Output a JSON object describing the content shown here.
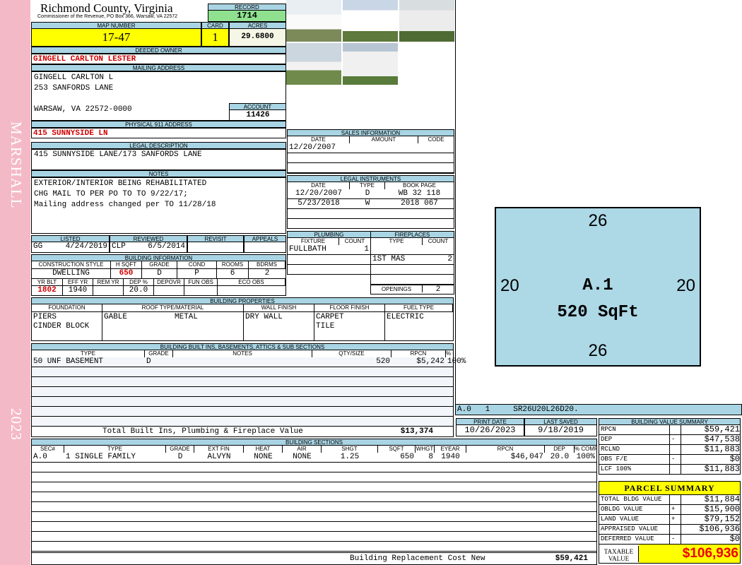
{
  "side": {
    "district": "MARSHALL",
    "year": "2023"
  },
  "header": {
    "county": "Richmond County, Virginia",
    "office": "Commissioner of the Revenue, PO Box 366, Warsaw, VA 22572",
    "record_label": "RECORD",
    "record": "1714"
  },
  "parcel": {
    "map_label": "MAP NUMBER",
    "map": "17-47",
    "card_label": "CARD",
    "card": "1",
    "acres_label": "ACRES",
    "acres": "29.6800"
  },
  "owner": {
    "label": "DEEDED OWNER",
    "name": "GINGELL CARLTON LESTER"
  },
  "mailing": {
    "label": "MAILING ADDRESS",
    "line1": "GINGELL CARLTON L",
    "line2": "253 SANFORDS LANE",
    "line3": "WARSAW, VA 22572-0000",
    "account_label": "ACCOUNT",
    "account": "11426"
  },
  "physical": {
    "label": "PHYSICAL 911 ADDRESS",
    "value": "415 SUNNYSIDE LN"
  },
  "legal": {
    "label": "LEGAL DESCRIPTION",
    "value": "415 SUNNYSIDE LANE/173 SANFORDS LANE"
  },
  "notes": {
    "label": "NOTES",
    "lines": [
      "EXTERIOR/INTERIOR BEING REHABILITATED",
      "CHG MAIL TO PER PO TO TO 9/22/17;",
      "Mailing address changed per TO 11/28/18"
    ]
  },
  "review": {
    "listed_label": "LISTED",
    "reviewed_label": "REVIEWED",
    "revisit_label": "REVISIT",
    "appeals_label": "APPEALS",
    "listed_by": "GG",
    "listed_date": "4/24/2019",
    "reviewed_by": "CLP",
    "reviewed_date": "6/5/2014"
  },
  "building_info": {
    "label": "BUILDING INFORMATION",
    "h": [
      "CONSTRUCTION STYLE",
      "H SQFT",
      "GRADE",
      "COND",
      "ROOMS",
      "BDRMS"
    ],
    "v": [
      "DWELLING",
      "650",
      "D",
      "P",
      "6",
      "2"
    ],
    "h2": [
      "YR BLT",
      "EFF YR",
      "REM YR",
      "DEP %",
      "DEPOVR",
      "FUN OBS",
      "ECO OBS"
    ],
    "v2": [
      "1802",
      "1940",
      "",
      "20.0",
      "",
      "",
      ""
    ]
  },
  "sales": {
    "label": "SALES INFORMATION",
    "h": [
      "DATE",
      "AMOUNT",
      "CODE"
    ],
    "rows": [
      [
        "12/20/2007",
        "",
        ""
      ]
    ]
  },
  "instruments": {
    "label": "LEGAL INSTRUMENTS",
    "h": [
      "DATE",
      "TYPE",
      "BOOK PAGE"
    ],
    "rows": [
      [
        "12/20/2007",
        "D",
        "WB 32 118"
      ],
      [
        "5/23/2018",
        "W",
        "2018 067"
      ]
    ]
  },
  "plumbing": {
    "label": "PLUMBING",
    "h": [
      "FIXTURE",
      "COUNT"
    ],
    "rows": [
      [
        "FULLBATH",
        "1"
      ]
    ]
  },
  "fireplaces": {
    "label": "FIREPLACES",
    "h": [
      "TYPE",
      "COUNT"
    ],
    "rows": [
      [
        "1ST MAS",
        "2"
      ]
    ],
    "openings_label": "OPENINGS",
    "openings": "2"
  },
  "properties": {
    "label": "BUILDING PROPERTIES",
    "h": [
      "FOUNDATION",
      "ROOF TYPE/MATERIAL",
      "WALL FINISH",
      "FLOOR FINISH",
      "FUEL TYPE"
    ],
    "foundation": [
      "PIERS",
      "CINDER BLOCK"
    ],
    "roof_type": "GABLE",
    "roof_material": "METAL",
    "wall": "DRY WALL",
    "floor": [
      "CARPET",
      "TILE"
    ],
    "fuel": "ELECTRIC"
  },
  "builtins": {
    "label": "BUILDING BUILT INS, BASEMENTS, ATTICS & SUB SECTIONS",
    "h": [
      "TYPE",
      "GRADE",
      "NOTES",
      "QTY/SIZE",
      "RPCN",
      "% COMP"
    ],
    "rows": [
      [
        "50 UNF BASEMENT",
        "D",
        "",
        "520",
        "$5,242",
        "100%"
      ]
    ],
    "total_label": "Total Built Ins, Plumbing & Fireplace Value",
    "total": "$13,374"
  },
  "sketch": {
    "top": "26",
    "bottom": "26",
    "left": "20",
    "right": "20",
    "code": "A.1",
    "area": "520 SqFt",
    "vector": "A.0   1     SR26U20L26D20."
  },
  "dates": {
    "print_label": "PRINT DATE",
    "print": "10/26/2023",
    "saved_label": "LAST SAVED",
    "saved": "9/18/2019"
  },
  "sections": {
    "label": "BUILDING SECTIONS",
    "h": [
      "SEC#",
      "TYPE",
      "GRADE",
      "EXT FIN",
      "HEAT",
      "AIR",
      "SHGT",
      "SQFT",
      "WHGT",
      "EYEAR",
      "RPCN",
      "DEP",
      "% COMP"
    ],
    "rows": [
      [
        "A.0",
        "1 SINGLE FAMILY",
        "D",
        "ALVYN",
        "NONE",
        "NONE",
        "1.25",
        "650",
        "8",
        "1940",
        "$46,047",
        "20.0",
        "100%"
      ]
    ],
    "total_label": "Building Replacement Cost New",
    "total": "$59,421"
  },
  "value_summary": {
    "label": "BUILDING VALUE SUMMARY",
    "rows": [
      {
        "k": "RPCN",
        "s": "",
        "v": "$59,421"
      },
      {
        "k": "DEP",
        "s": "-",
        "v": "$47,538"
      },
      {
        "k": "RCLND",
        "s": "",
        "v": "$11,883"
      },
      {
        "k": "OBS F/E",
        "s": "-",
        "v": "$0"
      },
      {
        "k": "LCF        100%",
        "s": "",
        "v": "$11,883"
      }
    ]
  },
  "parcel_summary": {
    "label": "PARCEL SUMMARY",
    "rows": [
      {
        "k": "TOTAL BLDG VALUE",
        "s": "",
        "v": "$11,884"
      },
      {
        "k": "OBLDG VALUE",
        "s": "+",
        "v": "$15,900"
      },
      {
        "k": "LAND VALUE",
        "s": "+",
        "v": "$79,152"
      },
      {
        "k": "APPRAISED VALUE",
        "s": "",
        "v": "$106,936"
      },
      {
        "k": "DEFERRED VALUE",
        "s": "-",
        "v": "$0"
      }
    ],
    "taxable_label": "TAXABLE VALUE",
    "taxable": "$106,936"
  },
  "colors": {
    "header": "#a9d4e3",
    "highlight": "#ffff00",
    "record": "#8fe08f",
    "strip": "#f4b9c6",
    "sketch": "#add8e6",
    "alert": "#d10000"
  }
}
